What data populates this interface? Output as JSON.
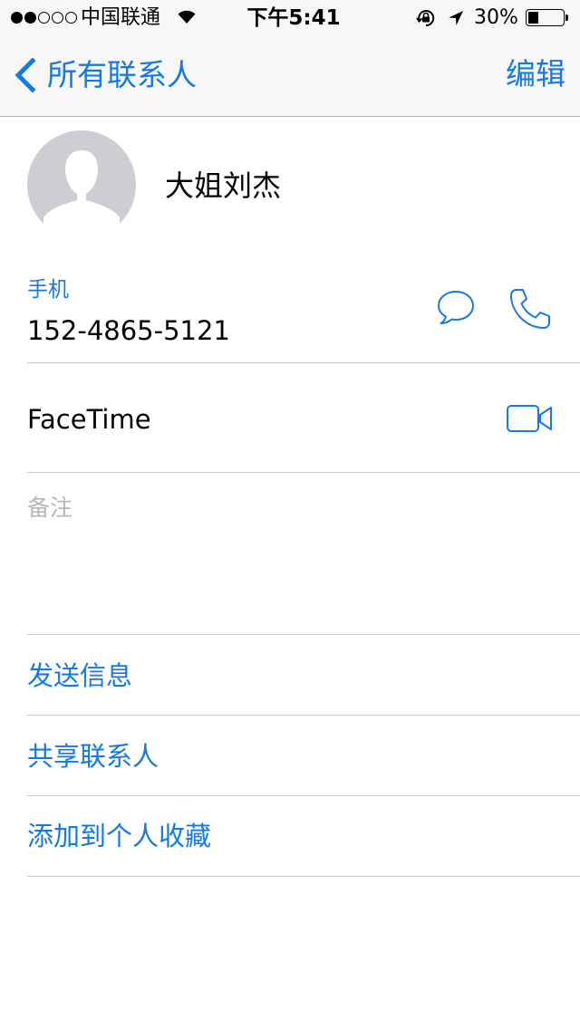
{
  "status_bar": {
    "signal_dots_total": 5,
    "signal_dots_filled": 2,
    "carrier": "中国联通",
    "time": "下午5:41",
    "battery_percent": "30%",
    "battery_level": 0.3
  },
  "nav": {
    "back_label": "所有联系人",
    "edit_label": "编辑"
  },
  "contact": {
    "name": "大姐刘杰",
    "phone_label": "手机",
    "phone_number": "152-4865-5121",
    "facetime_label": "FaceTime",
    "notes_label": "备注"
  },
  "actions": [
    {
      "label": "发送信息"
    },
    {
      "label": "共享联系人"
    },
    {
      "label": "添加到个人收藏"
    }
  ],
  "colors": {
    "accent": "#1479e4",
    "placeholder_gray": "#b6b6b6",
    "avatar_bg": "#cdcdd2",
    "separator": "#c8c7cc",
    "bar_bg": "#f7f7f7"
  },
  "icons": {
    "message": "message-bubble-icon",
    "phone": "phone-handset-icon",
    "video": "video-camera-icon",
    "back": "chevron-left-icon",
    "wifi": "wifi-icon",
    "lock": "rotation-lock-icon",
    "location": "location-arrow-icon"
  }
}
